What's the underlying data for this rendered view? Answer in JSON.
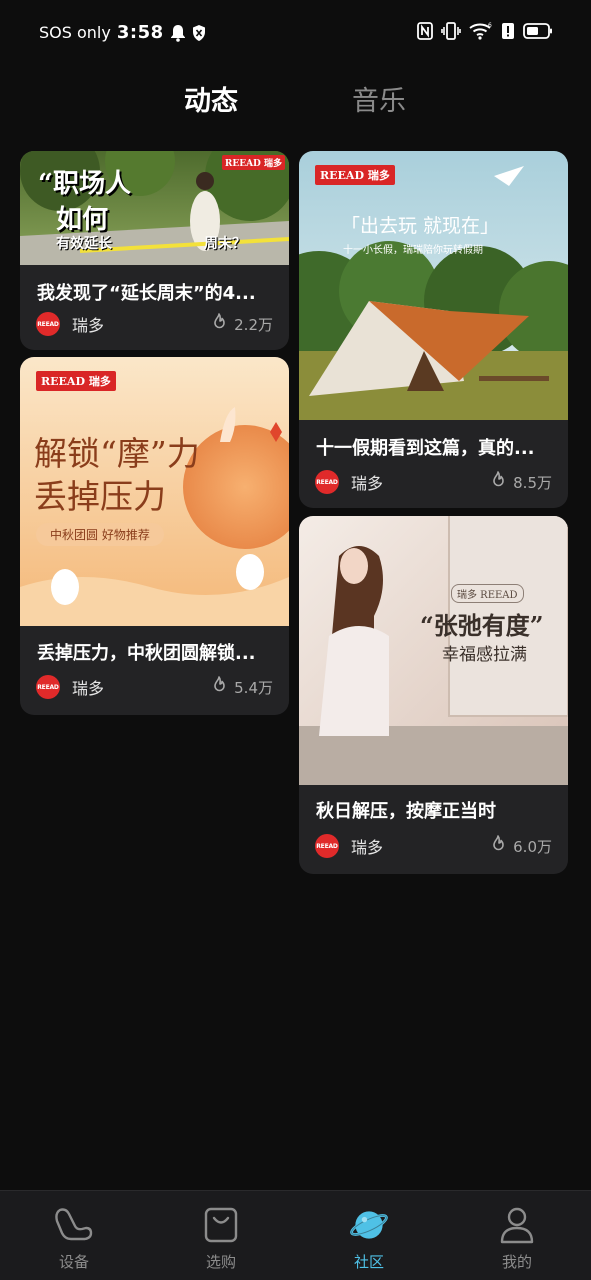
{
  "status_bar": {
    "sos": "SOS only",
    "time": "3:58"
  },
  "tabs": [
    {
      "label": "动态",
      "active": true
    },
    {
      "label": "音乐",
      "active": false
    }
  ],
  "cards": [
    {
      "title": "我发现了“延长周末”的4...",
      "author": "瑞多",
      "likes": "2.2万",
      "cover": {
        "line1": "“职场人",
        "line2": "如何",
        "line3": "有效延长",
        "line4": "周末？",
        "badge": "REEAD 瑞多"
      }
    },
    {
      "title": "十一假期看到这篇，真的...",
      "author": "瑞多",
      "likes": "8.5万",
      "cover": {
        "headline": "「出去玩  就现在」",
        "sub": "十一小长假，瑞瑞陪你玩转假期",
        "badge": "REEAD 瑞多"
      }
    },
    {
      "title": "丢掉压力，中秋团圆解锁...",
      "author": "瑞多",
      "likes": "5.4万",
      "cover": {
        "line1": "解锁“摩”力",
        "line2": "丢掉压力",
        "tag": "中秋团圆  好物推荐",
        "badge": "REEAD 瑞多"
      }
    },
    {
      "title": "秋日解压，按摩正当时",
      "author": "瑞多",
      "likes": "6.0万",
      "cover": {
        "headline": "“张弛有度”",
        "sub": "幸福感拉满",
        "badge": "瑞多  REEAD"
      }
    }
  ],
  "avatar_text": "REEAD",
  "bottom_nav": [
    {
      "label": "设备",
      "icon": "massage-chair-icon",
      "active": false
    },
    {
      "label": "选购",
      "icon": "shopping-bag-icon",
      "active": false
    },
    {
      "label": "社区",
      "icon": "planet-icon",
      "active": true
    },
    {
      "label": "我的",
      "icon": "profile-icon",
      "active": false
    }
  ],
  "colors": {
    "background": "#0d0d0d",
    "card": "#232325",
    "accent": "#4fc1e6",
    "brand_red": "#e02a2a"
  }
}
